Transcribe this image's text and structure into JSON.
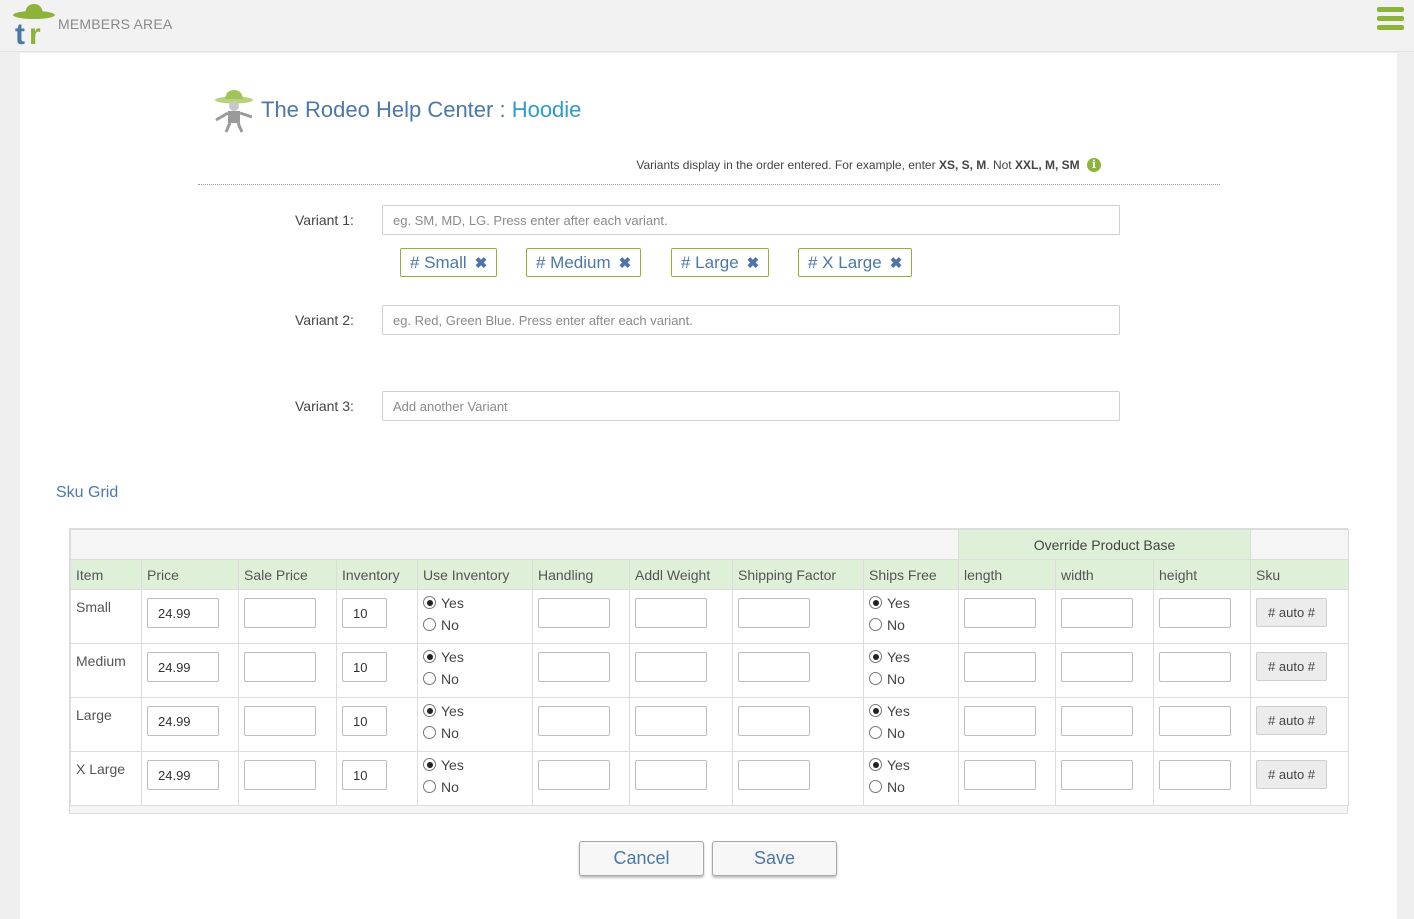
{
  "topbar": {
    "members_label": "MEMBERS AREA",
    "logo_text": "tr",
    "menu_icon": "hamburger-menu-icon"
  },
  "page": {
    "title": "The Rodeo Help Center :",
    "subtitle": "Hoodie"
  },
  "hint": {
    "prefix": "Variants display in the order entered. For example, enter",
    "good_example": "XS, S, M",
    "middle": ". Not",
    "bad_example": "XXL, M, SM",
    "icon": "info-icon"
  },
  "variants": [
    {
      "label": "Variant 1:",
      "placeholder": "eg. SM, MD, LG. Press enter after each variant."
    },
    {
      "label": "Variant 2:",
      "placeholder": "eg. Red, Green Blue. Press enter after each variant."
    },
    {
      "label": "Variant 3:",
      "placeholder": "Add another Variant"
    }
  ],
  "tags": [
    "# Small",
    "# Medium",
    "# Large",
    "# X Large"
  ],
  "sku_grid": {
    "title": "Sku Grid",
    "override_header": "Override Product Base",
    "columns": [
      "Item",
      "Price",
      "Sale Price",
      "Inventory",
      "Use Inventory",
      "Handling",
      "Addl Weight",
      "Shipping Factor",
      "Ships Free",
      "length",
      "width",
      "height",
      "Sku"
    ],
    "yes_label": "Yes",
    "no_label": "No",
    "sku_button": "# auto #",
    "rows": [
      {
        "item": "Small",
        "price": "24.99",
        "sale_price": "",
        "inventory": "10",
        "use_inventory": "Yes",
        "ships_free": "Yes"
      },
      {
        "item": "Medium",
        "price": "24.99",
        "sale_price": "",
        "inventory": "10",
        "use_inventory": "Yes",
        "ships_free": "Yes"
      },
      {
        "item": "Large",
        "price": "24.99",
        "sale_price": "",
        "inventory": "10",
        "use_inventory": "Yes",
        "ships_free": "Yes"
      },
      {
        "item": "X Large",
        "price": "24.99",
        "sale_price": "",
        "inventory": "10",
        "use_inventory": "Yes",
        "ships_free": "Yes"
      }
    ]
  },
  "actions": {
    "cancel": "Cancel",
    "save": "Save"
  },
  "colors": {
    "brand_green": "#8db33a",
    "title_blue": "#4b78a8",
    "header_green": "#dff0d8"
  }
}
